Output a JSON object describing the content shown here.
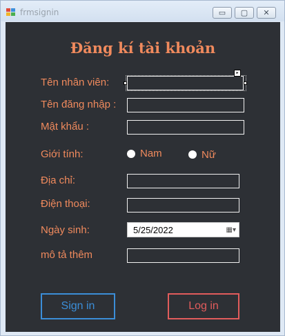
{
  "window": {
    "title": "frmsignin",
    "controls": {
      "minimize": "▭",
      "maximize": "▢",
      "close": "✕"
    }
  },
  "form": {
    "heading": "Đăng kí tài khoản",
    "fields": {
      "employee_name": {
        "label": "Tên nhân viên:",
        "value": ""
      },
      "username": {
        "label": "Tên đăng nhập :",
        "value": ""
      },
      "password": {
        "label": "Mật khẩu :",
        "value": ""
      },
      "gender": {
        "label": "Giới tính:",
        "options": [
          "Nam",
          "Nữ"
        ]
      },
      "address": {
        "label": "Địa chỉ:",
        "value": ""
      },
      "phone": {
        "label": "Điện thoại:",
        "value": ""
      },
      "birthday": {
        "label": "Ngày sinh:",
        "value": "5/25/2022",
        "icon": "calendar-dropdown-icon"
      },
      "description": {
        "label": "mô tả thêm",
        "value": ""
      }
    },
    "buttons": {
      "signin": "Sign in",
      "login": "Log in"
    }
  },
  "colors": {
    "background": "#2d3035",
    "label": "#f08a5d",
    "signin": "#3b8ed8",
    "login": "#e25c5c"
  }
}
